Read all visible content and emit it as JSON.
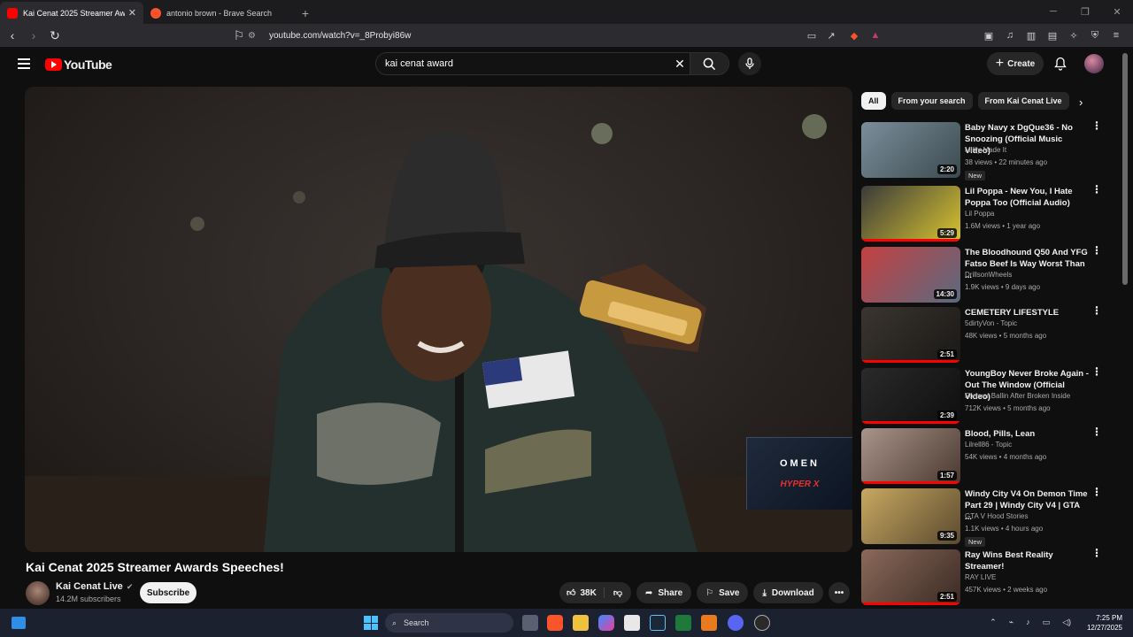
{
  "browser": {
    "tabs": [
      {
        "title": "Kai Cenat 2025 Streamer Aw",
        "active": true,
        "favicon_color": "#ff0000"
      },
      {
        "title": "antonio brown - Brave Search",
        "active": false,
        "favicon_color": "#fb542b"
      }
    ],
    "url": "youtube.com/watch?v=_8Probyi86w"
  },
  "yt": {
    "logo": "YouTube",
    "search_value": "kai cenat award",
    "create_label": "Create"
  },
  "ad": {
    "brand1": "OMEN",
    "brand2": "HYPER X"
  },
  "video": {
    "title": "Kai Cenat 2025 Streamer Awards Speeches!",
    "channel": "Kai Cenat Live",
    "subscribers": "14.2M subscribers",
    "subscribe_label": "Subscribe",
    "likes": "38K",
    "share_label": "Share",
    "save_label": "Save",
    "download_label": "Download"
  },
  "chips": [
    "All",
    "From your search",
    "From Kai Cenat Live"
  ],
  "recs": [
    {
      "title": "Baby Navy x DgQue36 - No Snoozing (Official Music Video)",
      "channel": "Milky Made It",
      "meta": "38 views • 22 minutes ago",
      "duration": "2:20",
      "badge": "New",
      "colors": [
        "#7a8e9a",
        "#3c4a50"
      ],
      "progress": 0
    },
    {
      "title": "Lil Poppa - New You, I Hate Poppa Too (Official Audio)",
      "channel": "Lil Poppa",
      "meta": "1.6M views • 1 year ago",
      "duration": "5:29",
      "badge": "",
      "colors": [
        "#3a3a3a",
        "#d8c430"
      ],
      "progress": 100
    },
    {
      "title": "The Bloodhound Q50 And YFG Fatso Beef Is Way Worst Than ...",
      "channel": "DrillsonWheels",
      "meta": "1.9K views • 9 days ago",
      "duration": "14:30",
      "badge": "",
      "colors": [
        "#c44040",
        "#5a6a80"
      ],
      "progress": 0
    },
    {
      "title": "CEMETERY LIFESTYLE",
      "channel": "5dirtyVon - Topic",
      "meta": "48K views • 5 months ago",
      "duration": "2:51",
      "badge": "",
      "colors": [
        "#3a3530",
        "#1a1816"
      ],
      "progress": 100
    },
    {
      "title": "YoungBoy Never Broke Again - Out The Window (Official Video)",
      "channel": "Forever Ballin After Broken Inside",
      "meta": "712K views • 5 months ago",
      "duration": "2:39",
      "badge": "",
      "colors": [
        "#2a2a2a",
        "#0e0e0e"
      ],
      "progress": 100
    },
    {
      "title": "Blood, Pills, Lean",
      "channel": "Lilrell86 - Topic",
      "meta": "54K views • 4 months ago",
      "duration": "1:57",
      "badge": "",
      "colors": [
        "#a8948a",
        "#4a3830"
      ],
      "progress": 100
    },
    {
      "title": "Windy City V4 On Demon Time Part 29 | Windy City V4 | GTA ...",
      "channel": "GTA V Hood Stories",
      "meta": "1.1K views • 4 hours ago",
      "duration": "9:35",
      "badge": "New",
      "colors": [
        "#c8a860",
        "#5a4a30"
      ],
      "progress": 0
    },
    {
      "title": "Ray Wins Best Reality Streamer!",
      "channel": "RAY LIVE",
      "meta": "457K views • 2 weeks ago",
      "duration": "2:51",
      "badge": "",
      "colors": [
        "#8a6a5a",
        "#3a2a24"
      ],
      "progress": 100
    }
  ],
  "taskbar": {
    "search_label": "Search",
    "time": "7:25 PM",
    "date": "12/27/2025"
  }
}
